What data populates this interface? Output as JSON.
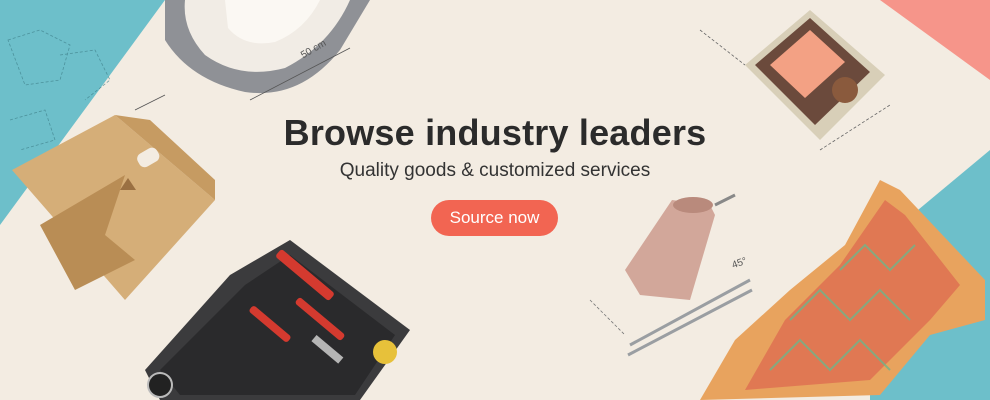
{
  "banner": {
    "headline": "Browse industry leaders",
    "subheadline": "Quality goods & customized services",
    "cta_label": "Source now",
    "dimension_labels": {
      "pet_bed": "50 cm",
      "tumbler": "45°"
    }
  },
  "colors": {
    "background": "#f3ece2",
    "teal_accent": "#6dbfca",
    "coral_accent": "#f6958a",
    "button": "#f26552",
    "headline_text": "#2b2b2b"
  },
  "products": [
    {
      "name": "pet-bed",
      "icon": "pet-bed-image"
    },
    {
      "name": "gift-bag",
      "icon": "kraft-gift-bag-image"
    },
    {
      "name": "tool-kit",
      "icon": "tool-case-image"
    },
    {
      "name": "makeup-palette",
      "icon": "blush-compact-image"
    },
    {
      "name": "tumbler",
      "icon": "steel-tumbler-image"
    },
    {
      "name": "dress",
      "icon": "patterned-dress-image"
    }
  ]
}
